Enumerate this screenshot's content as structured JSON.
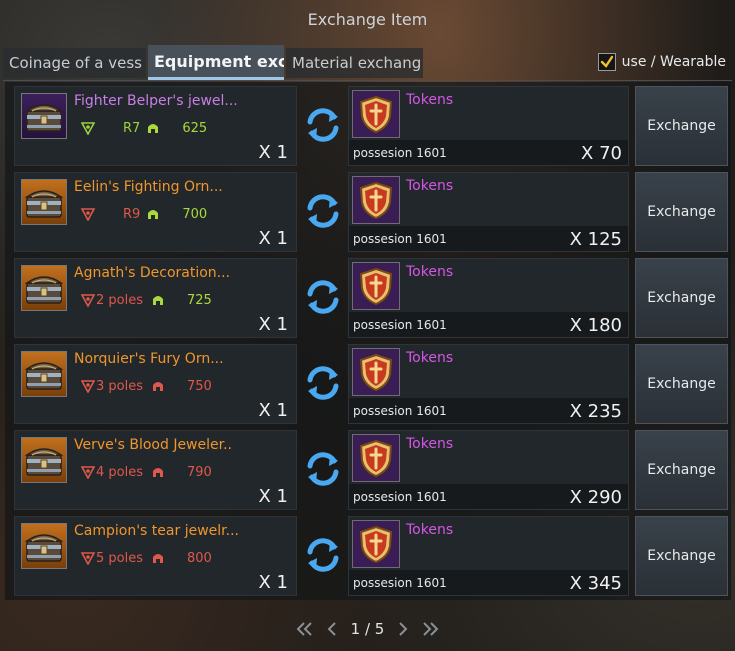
{
  "window": {
    "title": "Exchange Item"
  },
  "tabs": [
    {
      "label": "Coinage of a vess"
    },
    {
      "label": "Equipment excl"
    },
    {
      "label": "Material exchang"
    }
  ],
  "filter": {
    "label": "use / Wearable",
    "checked": true
  },
  "rows": [
    {
      "name": "Fighter Belper's jewel...",
      "grade": "purple",
      "name_color": "#c97ee6",
      "poles": "",
      "rank": "R7",
      "rank_color": "#9ad23a",
      "stat_color": "#a9d93a",
      "level": "625",
      "qty": "X 1",
      "cost": {
        "name": "Tokens",
        "possession": "possesion 1601",
        "qty": "X 70"
      },
      "button": "Exchange"
    },
    {
      "name": "Eelin's Fighting Orn...",
      "grade": "orange",
      "name_color": "#f0962a",
      "poles": "",
      "rank": "R9",
      "rank_color": "#e0584a",
      "stat_color": "#a9d93a",
      "level": "700",
      "qty": "X 1",
      "cost": {
        "name": "Tokens",
        "possession": "possesion 1601",
        "qty": "X 125"
      },
      "button": "Exchange"
    },
    {
      "name": "Agnath's Decoration...",
      "grade": "orange",
      "name_color": "#f0962a",
      "poles": "2 poles",
      "rank": "",
      "rank_color": "#e0584a",
      "stat_color": "#a9d93a",
      "level": "725",
      "qty": "X 1",
      "cost": {
        "name": "Tokens",
        "possession": "possesion 1601",
        "qty": "X 180"
      },
      "button": "Exchange"
    },
    {
      "name": "Norquier's Fury Orn...",
      "grade": "orange",
      "name_color": "#f0962a",
      "poles": "3 poles",
      "rank": "",
      "rank_color": "#e0584a",
      "stat_color": "#e0584a",
      "level": "750",
      "qty": "X 1",
      "cost": {
        "name": "Tokens",
        "possession": "possesion 1601",
        "qty": "X 235"
      },
      "button": "Exchange"
    },
    {
      "name": "Verve's Blood Jeweler..",
      "grade": "orange",
      "name_color": "#f0962a",
      "poles": "4 poles",
      "rank": "",
      "rank_color": "#e0584a",
      "stat_color": "#e0584a",
      "level": "790",
      "qty": "X 1",
      "cost": {
        "name": "Tokens",
        "possession": "possesion 1601",
        "qty": "X 290"
      },
      "button": "Exchange"
    },
    {
      "name": "Campion's tear jewelr...",
      "grade": "orange",
      "name_color": "#f0962a",
      "poles": "5 poles",
      "rank": "",
      "rank_color": "#e0584a",
      "stat_color": "#e0584a",
      "level": "800",
      "qty": "X 1",
      "cost": {
        "name": "Tokens",
        "possession": "possesion 1601",
        "qty": "X 345"
      },
      "button": "Exchange"
    }
  ],
  "pagination": {
    "text": "1 / 5"
  },
  "colors": {
    "accent_tab": "#9fc6e6",
    "token_purple": "#d656e6",
    "check_yellow": "#f2c12e"
  },
  "icons": [
    "chest-icon",
    "shield-emblem-icon",
    "helmet-icon",
    "exchange-arrows-icon",
    "check-icon",
    "double-chevron-left-icon",
    "chevron-left-icon",
    "chevron-right-icon",
    "double-chevron-right-icon"
  ]
}
